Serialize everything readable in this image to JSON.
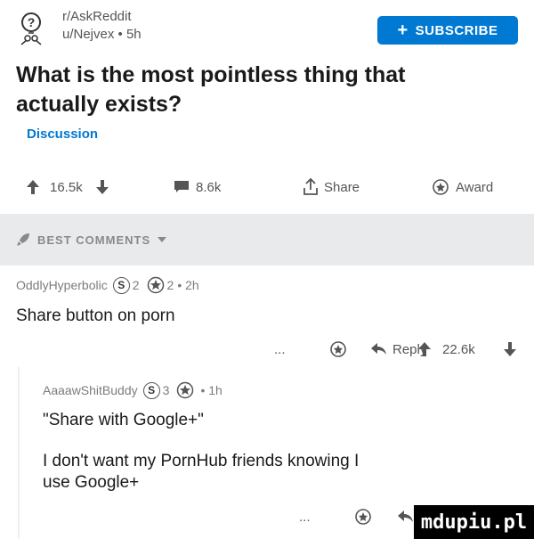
{
  "header": {
    "subreddit": "r/AskReddit",
    "author_line": "u/Nejvex • 5h",
    "subscribe_label": "SUBSCRIBE"
  },
  "post": {
    "title": "What is the most pointless thing that actually exists?",
    "flair": "Discussion",
    "votes": "16.5k",
    "comments": "8.6k",
    "share_label": "Share",
    "award_label": "Award"
  },
  "sort_bar": {
    "label": "BEST COMMENTS"
  },
  "comments": [
    {
      "meta_user": "OddlyHyperbolic",
      "badge_s_count": "2",
      "badge_gold_count": "2",
      "meta_time": "• 2h",
      "text": "Share button on porn",
      "more": "...",
      "reply_label": "Reply",
      "votes": "22.6k"
    },
    {
      "meta_user": "AaaawShitBuddy",
      "badge_s_count": "3",
      "meta_time": "• 1h",
      "text_line1": "\"Share with Google+\"",
      "text_line2": "I don't want my PornHub friends knowing I",
      "text_line3": "use Google+",
      "more": "..."
    }
  ],
  "watermark": "mdupiu.pl",
  "colors": {
    "accent": "#0079d3",
    "bar": "#e9eaec",
    "text": "#1a1a1b",
    "muted": "#7c7c7c"
  }
}
